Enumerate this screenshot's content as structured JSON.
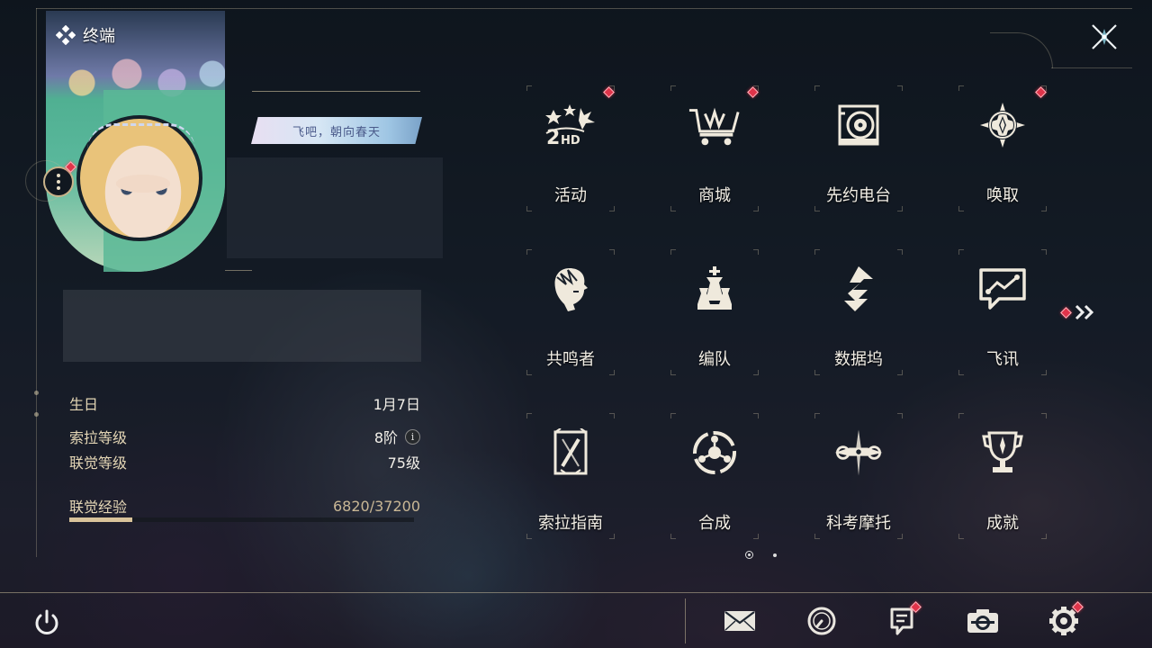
{
  "profile": {
    "panel_title": "终端",
    "signature": "飞吧，朝向春天",
    "stats": [
      {
        "label": "生日",
        "value": "1月7日"
      },
      {
        "label": "索拉等级",
        "value": "8阶"
      },
      {
        "label": "联觉等级",
        "value": "75级"
      }
    ],
    "experience": {
      "label": "联觉经验",
      "value": "6820/37200",
      "current": 6820,
      "max": 37200
    }
  },
  "menu": {
    "items": [
      {
        "label": "活动",
        "icon": "activity-2hd-icon",
        "badge": true
      },
      {
        "label": "商城",
        "icon": "shop-cart-icon",
        "badge": true
      },
      {
        "label": "先约电台",
        "icon": "radio-icon",
        "badge": false
      },
      {
        "label": "唤取",
        "icon": "convene-compass-icon",
        "badge": true
      },
      {
        "label": "共鸣者",
        "icon": "resonator-head-icon",
        "badge": false
      },
      {
        "label": "编队",
        "icon": "team-chess-icon",
        "badge": false
      },
      {
        "label": "数据坞",
        "icon": "data-bank-icon",
        "badge": false
      },
      {
        "label": "飞讯",
        "icon": "chat-bubble-icon",
        "badge": false
      },
      {
        "label": "索拉指南",
        "icon": "guidebook-icon",
        "badge": false
      },
      {
        "label": "合成",
        "icon": "synthesis-icon",
        "badge": false
      },
      {
        "label": "科考摩托",
        "icon": "motorcycle-icon",
        "badge": false
      },
      {
        "label": "成就",
        "icon": "trophy-icon",
        "badge": false
      }
    ],
    "pages": 2,
    "current_page": 1
  },
  "bottom_bar": {
    "buttons": [
      "mail-icon",
      "clock-icon",
      "notice-icon",
      "camera-icon",
      "settings-gear-icon"
    ]
  },
  "colors": {
    "accent": "#d9c39a",
    "badge": "#e0344a",
    "text": "#f3efe6"
  }
}
